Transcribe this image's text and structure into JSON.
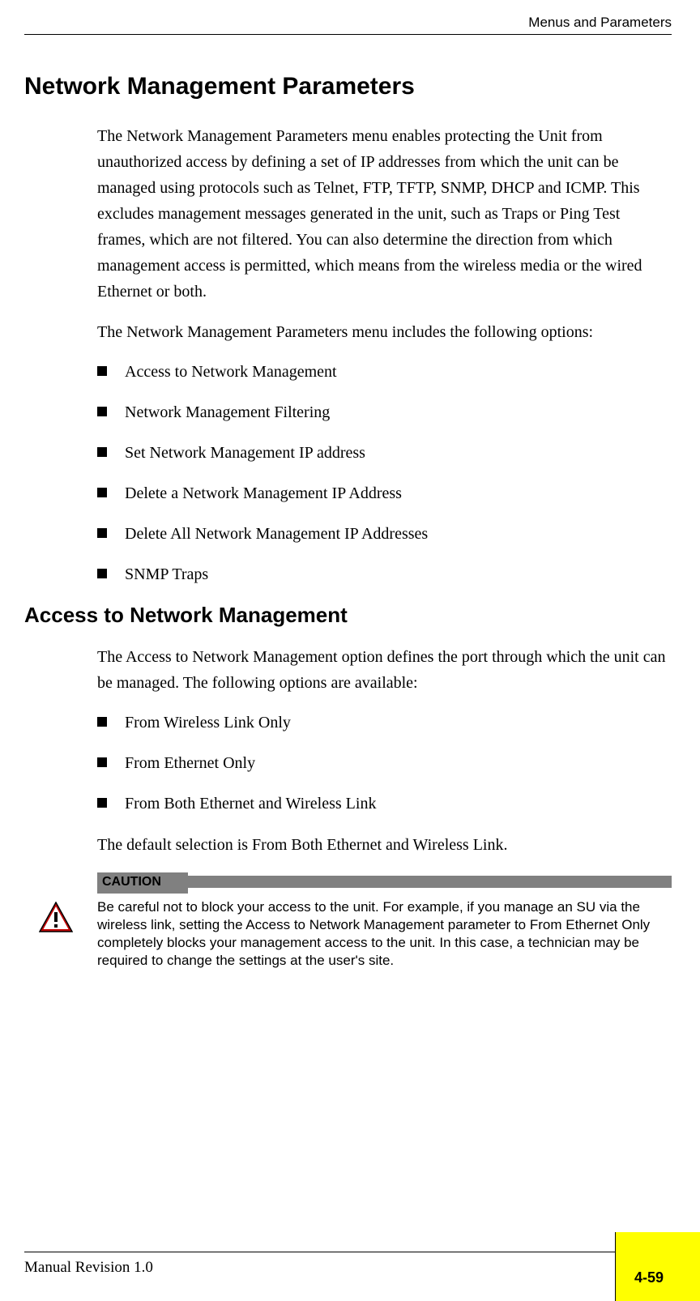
{
  "header": {
    "section": "Menus and Parameters"
  },
  "main": {
    "h1": "Network Management Parameters",
    "p1": "The Network Management Parameters menu enables protecting the Unit from unauthorized access by defining a set of IP addresses from which the unit can be managed using protocols such as Telnet, FTP, TFTP, SNMP, DHCP and ICMP. This excludes management messages generated in the unit, such as Traps or Ping Test frames, which are not filtered. You can also determine the direction from which management access is permitted, which means from the wireless media or the wired Ethernet or both.",
    "p2": "The Network Management Parameters menu includes the following options:",
    "options1": [
      "Access to Network Management",
      "Network Management Filtering",
      "Set Network Management IP address",
      "Delete a Network Management IP Address",
      "Delete All Network Management IP Addresses",
      "SNMP Traps"
    ],
    "h2": "Access to Network Management",
    "p3": "The Access to Network Management option defines the port through which the unit can be managed. The following options are available:",
    "options2": [
      "From Wireless Link Only",
      "From Ethernet Only",
      "From Both Ethernet and Wireless Link"
    ],
    "p4": "The default selection is From Both Ethernet and Wireless Link.",
    "caution": {
      "label": "CAUTION",
      "text": "Be careful not to block your access to the unit. For example, if you manage an SU via the wireless link, setting the Access to Network Management parameter to From Ethernet Only completely blocks your management access to the unit. In this case, a technician may be required to change the settings at the user's site."
    }
  },
  "footer": {
    "revision": "Manual Revision 1.0",
    "page": "4-59"
  }
}
